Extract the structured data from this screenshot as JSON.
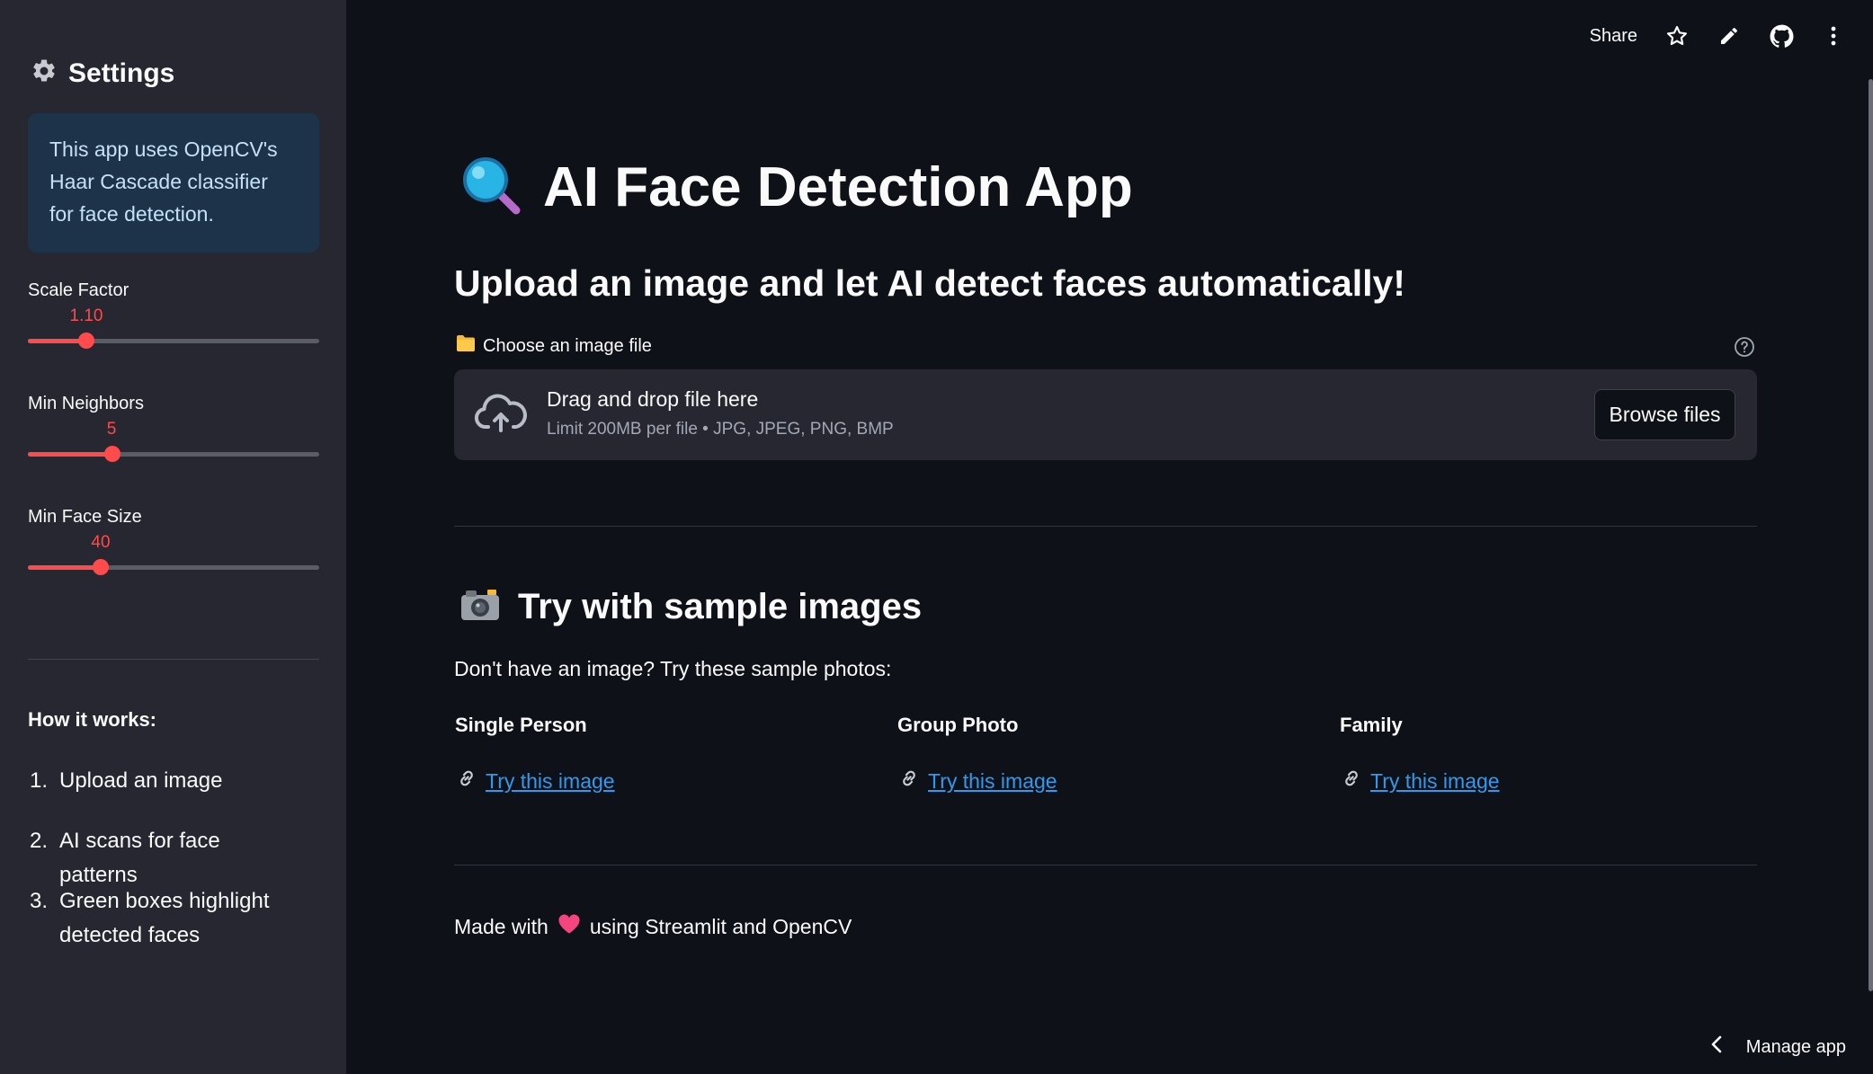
{
  "sidebar": {
    "title": "Settings",
    "icon": "gear-icon",
    "info": "This app uses OpenCV's Haar Cascade classifier for face detection.",
    "sliders": [
      {
        "label": "Scale Factor",
        "value": "1.10",
        "fraction": 0.2
      },
      {
        "label": "Min Neighbors",
        "value": "5",
        "fraction": 0.29
      },
      {
        "label": "Min Face Size",
        "value": "40",
        "fraction": 0.25
      }
    ],
    "how_title": "How it works:",
    "how_items": [
      {
        "num": "1.",
        "text": "Upload an image"
      },
      {
        "num": "2.",
        "text": "AI scans for face patterns"
      },
      {
        "num": "3.",
        "text": "Green boxes highlight detected faces"
      }
    ]
  },
  "toolbar": {
    "share": "Share",
    "icons": [
      "star-icon",
      "pencil-icon",
      "github-icon",
      "more-vertical-icon"
    ]
  },
  "main": {
    "title": "AI Face Detection App",
    "title_icon": "magnifying-glass-icon",
    "subtitle": "Upload an image and let AI detect faces automatically!",
    "uploader": {
      "label": "Choose an image file",
      "drop_title": "Drag and drop file here",
      "drop_sub": "Limit 200MB per file • JPG, JPEG, PNG, BMP",
      "button": "Browse files"
    },
    "samples": {
      "title": "Try with sample images",
      "desc": "Don't have an image? Try these sample photos:",
      "columns": [
        {
          "title": "Single Person",
          "link": "Try this image"
        },
        {
          "title": "Group Photo",
          "link": "Try this image"
        },
        {
          "title": "Family",
          "link": "Try this image"
        }
      ]
    },
    "footer": {
      "prefix": "Made with",
      "suffix": "using Streamlit and OpenCV"
    }
  },
  "manage": "Manage app",
  "colors": {
    "background": "#0e1117",
    "sidebar": "#262730",
    "accent": "#ff4b4b",
    "link": "#2e9af0",
    "info_bg": "#1c3349"
  }
}
